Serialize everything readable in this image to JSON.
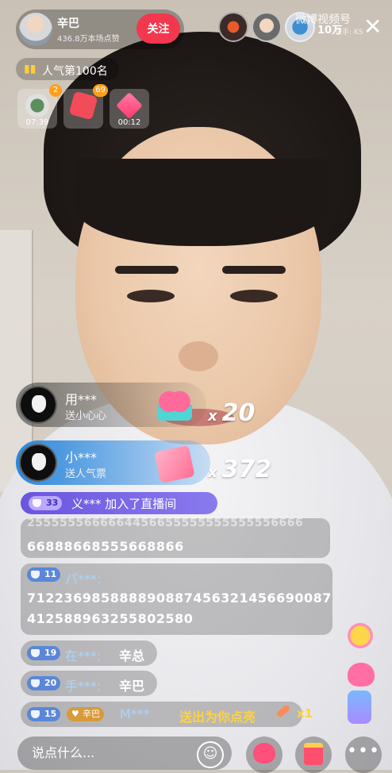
{
  "host": {
    "name": "辛巴",
    "subtitle": "436.8万本场点赞",
    "follow_label": "关注"
  },
  "viewers": {
    "count": "10万"
  },
  "close_label": "✕",
  "watermark": {
    "text": "微博视频号",
    "sub": "快手: KS"
  },
  "popularity": {
    "label": "人气第100名"
  },
  "boxes": [
    {
      "timer": "07:39",
      "badge": "2"
    },
    {
      "timer": "",
      "badge": "69"
    },
    {
      "timer": "00:12",
      "badge": ""
    }
  ],
  "gifts": [
    {
      "user": "用***",
      "action": "送小心心",
      "count": "20"
    },
    {
      "user": "小***",
      "action": "送人气票",
      "count": "372"
    }
  ],
  "join": {
    "level": "33",
    "text": "义*** 加入了直播间"
  },
  "chat": [
    {
      "clipped": "2555555666664456655555555555556666",
      "line": "66888668555668866"
    },
    {
      "level": "11",
      "user": "パ***:",
      "line1": "712236985888890887456321456690087",
      "line2": "412588963255802580"
    },
    {
      "level": "19",
      "user": "在***:",
      "content": "辛总"
    },
    {
      "level": "20",
      "user": "手***:",
      "content": "辛巴"
    },
    {
      "level": "15",
      "fan_badge": "辛巴",
      "user": "M***",
      "content": "送出为你点亮",
      "multiplier": "x1"
    }
  ],
  "input": {
    "placeholder": "说点什么..."
  },
  "more_label": "•••",
  "multiplier_prefix": "x",
  "colors": {
    "follow": "#f1384e",
    "gift_blue": "#2082dc",
    "join_purple": "#6a55e0",
    "gold_text": "#ffd23e"
  }
}
